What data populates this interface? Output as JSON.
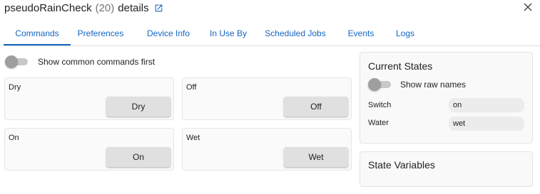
{
  "header": {
    "device_name": "pseudoRainCheck",
    "device_id": "(20)",
    "suffix": "details",
    "external_link_icon": "open-in-new-icon",
    "close_icon": "close-icon"
  },
  "tabs": [
    {
      "label": "Commands",
      "active": true
    },
    {
      "label": "Preferences",
      "active": false
    },
    {
      "label": "Device Info",
      "active": false
    },
    {
      "label": "In Use By",
      "active": false
    },
    {
      "label": "Scheduled Jobs",
      "active": false
    },
    {
      "label": "Events",
      "active": false
    },
    {
      "label": "Logs",
      "active": false
    }
  ],
  "commands": {
    "show_common_label": "Show common commands first",
    "show_common_enabled": false,
    "items": [
      {
        "name": "Dry",
        "button": "Dry"
      },
      {
        "name": "Off",
        "button": "Off"
      },
      {
        "name": "On",
        "button": "On"
      },
      {
        "name": "Wet",
        "button": "Wet"
      }
    ]
  },
  "current_states": {
    "title": "Current States",
    "show_raw_label": "Show raw names",
    "show_raw_enabled": false,
    "rows": [
      {
        "label": "Switch",
        "value": "on"
      },
      {
        "label": "Water",
        "value": "wet"
      }
    ]
  },
  "state_variables": {
    "title": "State Variables"
  },
  "colors": {
    "accent": "#1565c0",
    "toggle_off_knob": "#9e9e9e",
    "toggle_off_track": "#c8c8c8"
  }
}
